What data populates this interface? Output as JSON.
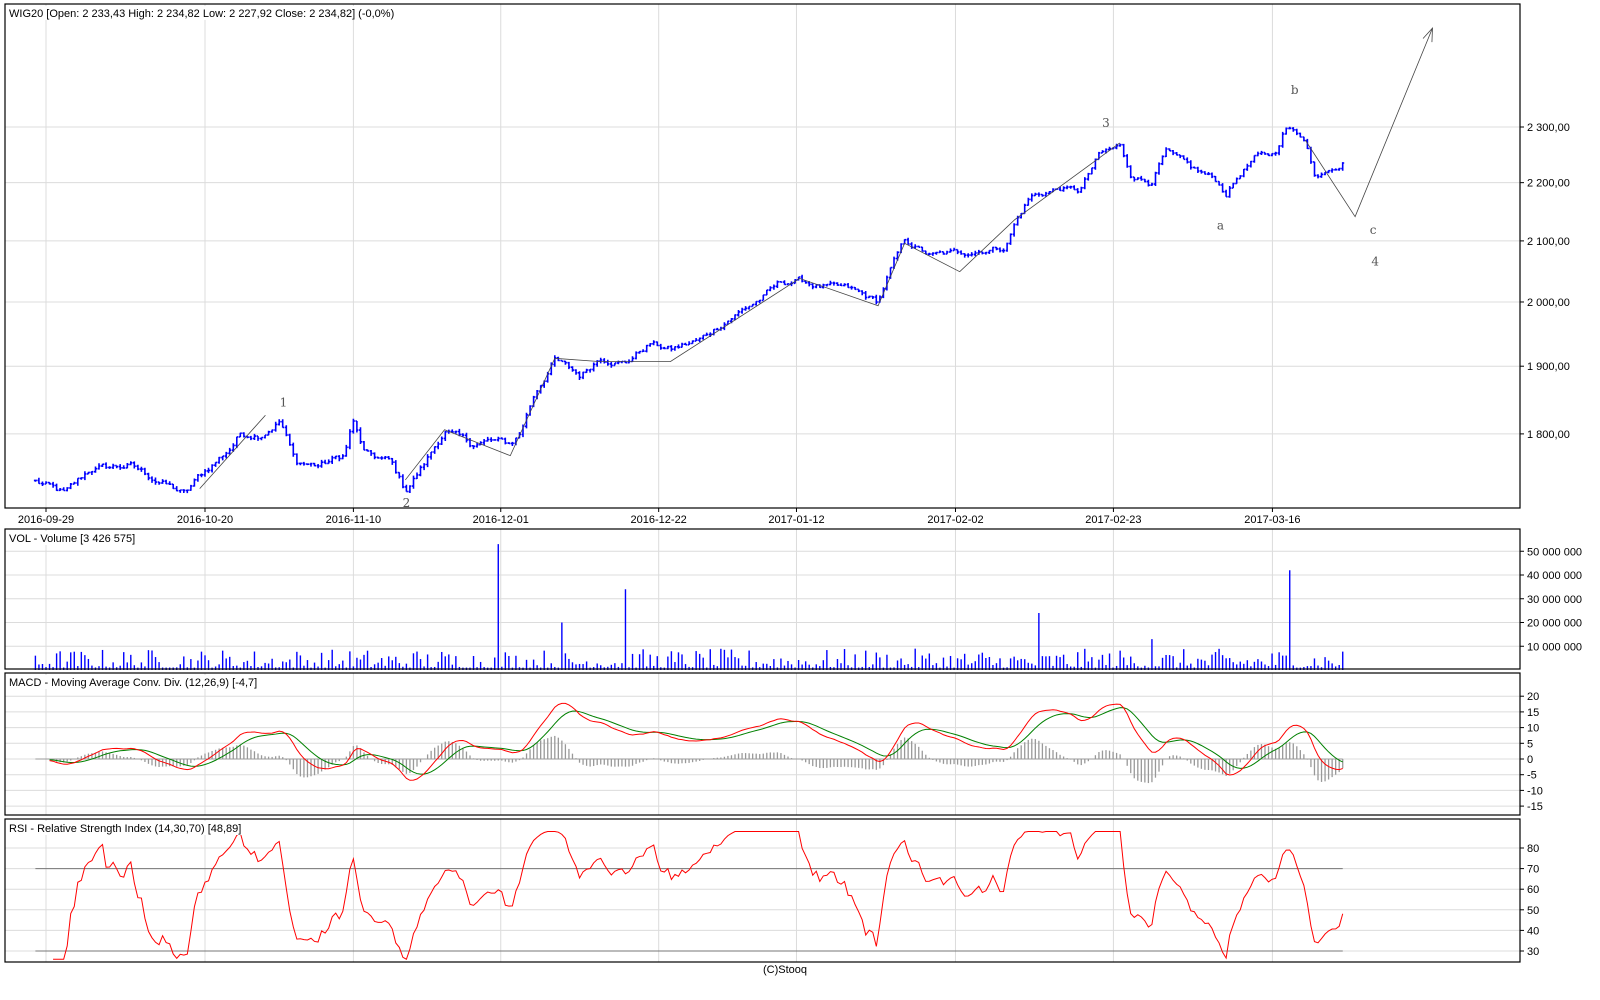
{
  "chart_data": [
    {
      "type": "line",
      "title": "WIG20 [Open: 2 233,43  High: 2 234,82  Low: 2 227,92  Close: 2 234,82] (-0,0%)",
      "x_unit": "trading day index (0 = 2016-09-29)",
      "x_ticks": [
        {
          "t": 0,
          "label": "2016-09-29"
        },
        {
          "t": 15,
          "label": "2016-10-20"
        },
        {
          "t": 29,
          "label": "2016-11-10"
        },
        {
          "t": 42.9,
          "label": "2016-12-01"
        },
        {
          "t": 57.8,
          "label": "2016-12-22"
        },
        {
          "t": 70.8,
          "label": "2017-01-12"
        },
        {
          "t": 85.8,
          "label": "2017-02-02"
        },
        {
          "t": 100.7,
          "label": "2017-02-23"
        },
        {
          "t": 115.7,
          "label": "2017-03-16"
        }
      ],
      "y_scale": "log",
      "y_ticks": [
        {
          "v": 2300,
          "label": "2 300,00"
        },
        {
          "v": 2200,
          "label": "2 200,00"
        },
        {
          "v": 2100,
          "label": "2 100,00"
        },
        {
          "v": 2000,
          "label": "2 000,00"
        },
        {
          "v": 1900,
          "label": "1 900,00"
        },
        {
          "v": 1800,
          "label": "1 800,00"
        }
      ],
      "series": [
        {
          "name": "WIG20",
          "color": "#0000ff",
          "points": [
            [
              -1,
              1733
            ],
            [
              1.8,
              1715
            ],
            [
              4.2,
              1750
            ],
            [
              7.9,
              1755
            ],
            [
              9.8,
              1740
            ],
            [
              13.1,
              1715
            ],
            [
              14.5,
              1740
            ],
            [
              17.4,
              1780
            ],
            [
              18.3,
              1800
            ],
            [
              20.2,
              1800
            ],
            [
              22.1,
              1820
            ],
            [
              23.5,
              1760
            ],
            [
              25.8,
              1755
            ],
            [
              28.2,
              1770
            ],
            [
              28.9,
              1820
            ],
            [
              30.1,
              1770
            ],
            [
              32.5,
              1760
            ],
            [
              33.9,
              1720
            ],
            [
              35.8,
              1760
            ],
            [
              37.6,
              1805
            ],
            [
              40.0,
              1785
            ],
            [
              41.9,
              1790
            ],
            [
              43.8,
              1785
            ],
            [
              44.7,
              1800
            ],
            [
              46.1,
              1860
            ],
            [
              48.0,
              1910
            ],
            [
              50.4,
              1885
            ],
            [
              52.3,
              1915
            ],
            [
              54.6,
              1905
            ],
            [
              57.0,
              1935
            ],
            [
              58.9,
              1925
            ],
            [
              61.7,
              1940
            ],
            [
              64.5,
              1975
            ],
            [
              67.4,
              2005
            ],
            [
              69.2,
              2030
            ],
            [
              71.1,
              2035
            ],
            [
              73.0,
              2025
            ],
            [
              75.8,
              2020
            ],
            [
              78.5,
              2000
            ],
            [
              79.6,
              2050
            ],
            [
              81.0,
              2100
            ],
            [
              83.4,
              2075
            ],
            [
              86.2,
              2080
            ],
            [
              88.1,
              2085
            ],
            [
              90.5,
              2090
            ],
            [
              91.4,
              2130
            ],
            [
              92.8,
              2175
            ],
            [
              95.7,
              2190
            ],
            [
              97.5,
              2185
            ],
            [
              99.4,
              2250
            ],
            [
              101.3,
              2265
            ],
            [
              102.3,
              2215
            ],
            [
              104.2,
              2200
            ],
            [
              105.6,
              2255
            ],
            [
              108.0,
              2225
            ],
            [
              110.3,
              2205
            ],
            [
              111.3,
              2180
            ],
            [
              112.6,
              2215
            ],
            [
              114.1,
              2245
            ],
            [
              115.9,
              2250
            ],
            [
              116.9,
              2300
            ],
            [
              118.8,
              2280
            ],
            [
              119.7,
              2210
            ],
            [
              121.1,
              2230
            ],
            [
              122.5,
              2235
            ]
          ]
        }
      ],
      "wave_lines": [
        [
          [
            14.5,
            1723
          ],
          [
            20.7,
            1827
          ]
        ],
        [
          [
            33.9,
            1735
          ],
          [
            37.6,
            1806
          ],
          [
            43.8,
            1769
          ],
          [
            48.0,
            1912
          ],
          [
            52.3,
            1907
          ],
          [
            58.9,
            1907
          ],
          [
            71.1,
            2038
          ],
          [
            78.5,
            1994
          ],
          [
            81.0,
            2096
          ],
          [
            86.2,
            2049
          ],
          [
            91.4,
            2136
          ],
          [
            101.3,
            2271
          ]
        ],
        [
          [
            118.8,
            2276
          ],
          [
            123.5,
            2141
          ],
          [
            130.8,
            2489
          ]
        ]
      ],
      "annotations": [
        {
          "text": "1",
          "t": 22.4,
          "v": 1846
        },
        {
          "text": "2",
          "t": 34.0,
          "v": 1703
        },
        {
          "text": "3",
          "t": 100.0,
          "v": 2307
        },
        {
          "text": "a",
          "t": 110.8,
          "v": 2126
        },
        {
          "text": "b",
          "t": 117.8,
          "v": 2369
        },
        {
          "text": "c",
          "t": 125.2,
          "v": 2118
        },
        {
          "text": "4",
          "t": 125.4,
          "v": 2066
        }
      ]
    },
    {
      "type": "bar",
      "title": "VOL - Volume [3 426 575]",
      "color": "#0000ff",
      "y_ticks": [
        {
          "v": 50000000,
          "label": "50 000 000"
        },
        {
          "v": 40000000,
          "label": "40 000 000"
        },
        {
          "v": 30000000,
          "label": "30 000 000"
        },
        {
          "v": 20000000,
          "label": "20 000 000"
        },
        {
          "v": 10000000,
          "label": "10 000 000"
        }
      ],
      "baseline_range": [
        1000000,
        9000000
      ],
      "spikes": [
        [
          42.6,
          53000000
        ],
        [
          48.6,
          20000000
        ],
        [
          54.6,
          34000000
        ],
        [
          93.7,
          24000000
        ],
        [
          104.4,
          13000000
        ],
        [
          117.4,
          42000000
        ]
      ]
    },
    {
      "type": "line",
      "title": "MACD - Moving Average Conv. Div. (12,26,9) [-4,7]",
      "params": [
        12,
        26,
        9
      ],
      "last_value": -4.7,
      "series": [
        {
          "name": "MACD",
          "color": "#ff0000"
        },
        {
          "name": "Signal",
          "color": "#008000"
        },
        {
          "name": "Histogram",
          "color": "#999999"
        }
      ],
      "y_ticks": [
        {
          "v": 20,
          "label": "20"
        },
        {
          "v": 15,
          "label": "15"
        },
        {
          "v": 10,
          "label": "10"
        },
        {
          "v": 5,
          "label": "5"
        },
        {
          "v": 0,
          "label": "0"
        },
        {
          "v": -5,
          "label": "-5"
        },
        {
          "v": -10,
          "label": "-10"
        },
        {
          "v": -15,
          "label": "-15"
        }
      ]
    },
    {
      "type": "line",
      "title": "RSI - Relative Strength Index (14,30,70) [48,89]",
      "params": [
        14,
        30,
        70
      ],
      "last_value": 48.89,
      "color": "#ff0000",
      "y_ticks": [
        {
          "v": 80,
          "label": "80"
        },
        {
          "v": 70,
          "label": "70"
        },
        {
          "v": 60,
          "label": "60"
        },
        {
          "v": 50,
          "label": "50"
        },
        {
          "v": 40,
          "label": "40"
        },
        {
          "v": 30,
          "label": "30"
        }
      ]
    }
  ],
  "footer": "(C)Stooq"
}
